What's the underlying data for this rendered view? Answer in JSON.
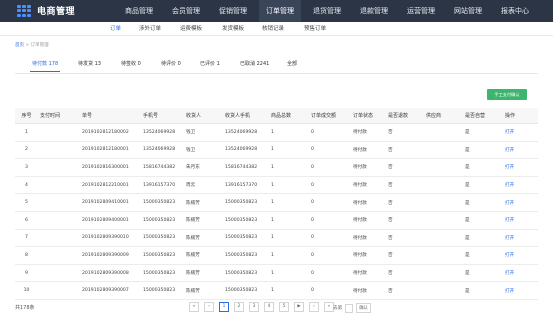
{
  "app": {
    "title": "电商管理"
  },
  "main_nav": [
    {
      "label": "商品管理",
      "active": false
    },
    {
      "label": "会员管理",
      "active": false
    },
    {
      "label": "促销管理",
      "active": false
    },
    {
      "label": "订单管理",
      "active": true
    },
    {
      "label": "退货管理",
      "active": false
    },
    {
      "label": "退款管理",
      "active": false
    },
    {
      "label": "运营管理",
      "active": false
    },
    {
      "label": "网站管理",
      "active": false
    },
    {
      "label": "报表中心",
      "active": false
    }
  ],
  "sub_nav": [
    {
      "label": "订单",
      "active": true
    },
    {
      "label": "涉外订单",
      "active": false
    },
    {
      "label": "运费模板",
      "active": false
    },
    {
      "label": "发货模板",
      "active": false
    },
    {
      "label": "核销记录",
      "active": false
    },
    {
      "label": "预售订单",
      "active": false
    }
  ],
  "breadcrumb": {
    "home": "首页",
    "separator": ">",
    "current": "订单管理"
  },
  "status_tabs": [
    {
      "label": "待付款 178",
      "active": true
    },
    {
      "label": "待发货 13",
      "active": false
    },
    {
      "label": "待签收 0",
      "active": false
    },
    {
      "label": "待评价 0",
      "active": false
    },
    {
      "label": "已评价 1",
      "active": false
    },
    {
      "label": "已取消 2241",
      "active": false
    },
    {
      "label": "全部",
      "active": false
    }
  ],
  "confirm_button": {
    "label": "手工支付确认"
  },
  "table": {
    "headers": [
      "序号",
      "支付时间",
      "单号",
      "手机号",
      "收货人",
      "收货人手机",
      "商品总数",
      "订单成交额",
      "订单状态",
      "是否退款",
      "供应商",
      "是否自营",
      "操作"
    ],
    "rows": [
      [
        "1",
        "",
        "2019102812180002",
        "13524069928",
        "钱卫",
        "13524069928",
        "1",
        "0",
        "待付款",
        "否",
        "",
        "是",
        "打开"
      ],
      [
        "2",
        "",
        "2019102812180001",
        "13524069928",
        "钱卫",
        "13524069928",
        "1",
        "0",
        "待付款",
        "否",
        "",
        "是",
        "打开"
      ],
      [
        "3",
        "",
        "2019102816300001",
        "15816744382",
        "朱月东",
        "15816744382",
        "1",
        "0",
        "待付款",
        "否",
        "",
        "是",
        "打开"
      ],
      [
        "4",
        "",
        "2019102812210001",
        "13916157370",
        "周云",
        "13916157370",
        "1",
        "0",
        "待付款",
        "否",
        "",
        "是",
        "打开"
      ],
      [
        "5",
        "",
        "2019102809410001",
        "15000350823",
        "陈楠芳",
        "15000350823",
        "1",
        "0",
        "待付款",
        "否",
        "",
        "是",
        "打开"
      ],
      [
        "6",
        "",
        "2019102809400001",
        "15000350823",
        "陈楠芳",
        "15000350823",
        "1",
        "0",
        "待付款",
        "否",
        "",
        "是",
        "打开"
      ],
      [
        "7",
        "",
        "2019102809390010",
        "15000350823",
        "陈楠芳",
        "15000350823",
        "1",
        "0",
        "待付款",
        "否",
        "",
        "是",
        "打开"
      ],
      [
        "8",
        "",
        "2019102809390009",
        "15000350823",
        "陈楠芳",
        "15000350823",
        "1",
        "0",
        "待付款",
        "否",
        "",
        "是",
        "打开"
      ],
      [
        "9",
        "",
        "2019102809390008",
        "15000350823",
        "陈楠芳",
        "15000350823",
        "1",
        "0",
        "待付款",
        "否",
        "",
        "是",
        "打开"
      ],
      [
        "10",
        "",
        "2019102809390007",
        "15000350823",
        "陈楠芳",
        "15000350823",
        "1",
        "0",
        "待付款",
        "否",
        "",
        "是",
        "打开"
      ]
    ]
  },
  "footer": {
    "total": "共178条",
    "pages": [
      "«",
      "‹",
      "1",
      "2",
      "3",
      "4",
      "5",
      "▶",
      "›",
      "»"
    ],
    "active_page": "1",
    "goto_prefix": "去第",
    "goto_button": "确认"
  },
  "colors": {
    "topbar": "#2c3546",
    "accent": "#2d6cdf",
    "confirm": "#3cb66e"
  }
}
